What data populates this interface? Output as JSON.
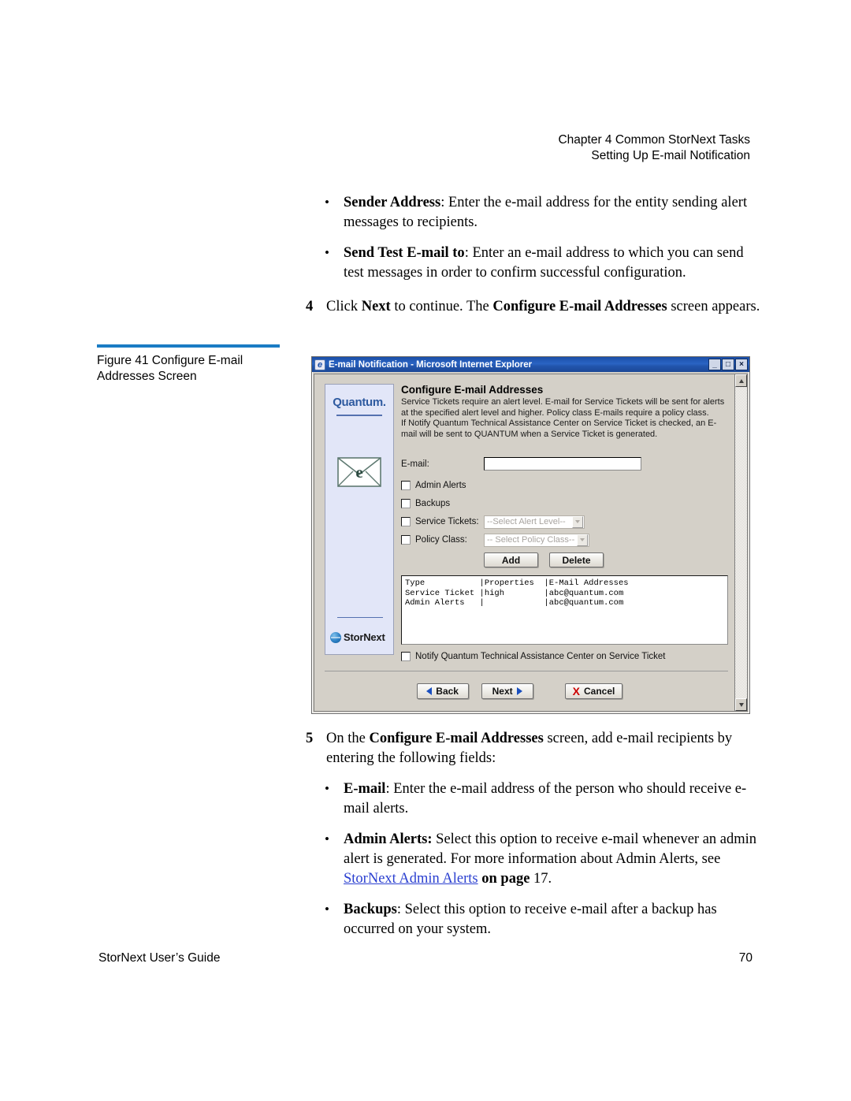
{
  "page_header": {
    "line1": "Chapter 4  Common StorNext Tasks",
    "line2": "Setting Up E-mail Notification"
  },
  "body": {
    "bullet1": {
      "bold": "Sender Address",
      "rest": ": Enter the e-mail address for the entity sending alert messages to recipients."
    },
    "bullet2": {
      "bold": "Send Test E-mail to",
      "rest": ": Enter an e-mail address to which you can send test messages in order to confirm successful configuration."
    },
    "step4": {
      "number": "4",
      "pre": "Click ",
      "bold1": "Next",
      "mid": " to continue. The ",
      "bold2": "Configure E-mail Addresses",
      "post": " screen appears."
    },
    "step5": {
      "number": "5",
      "pre": "On the ",
      "bold1": "Configure E-mail Addresses",
      "post": " screen, add e-mail recipients by entering the following fields:"
    },
    "bullet3": {
      "bold": "E-mail",
      "rest": ": Enter the e-mail address of the person who should receive e-mail alerts."
    },
    "bullet4": {
      "bold": "Admin Alerts:",
      "rest": " Select this option to receive e-mail whenever an admin alert is generated. For more information about Admin Alerts, see ",
      "link": "StorNext Admin Alerts",
      "tail_bold": " on page ",
      "tail": " 17."
    },
    "bullet5": {
      "bold": "Backups",
      "rest": ": Select this option to receive e-mail after a backup has occurred on your system."
    }
  },
  "figure": {
    "caption": "Figure 41  Configure E-mail Addresses Screen",
    "rule_color": "#1a7cc4"
  },
  "window": {
    "title": "E-mail Notification - Microsoft Internet Explorer",
    "icon": "internet-explorer-icon",
    "minimize": "_",
    "maximize": "□",
    "close": "×"
  },
  "sidebar": {
    "brand": "Quantum.",
    "envelope_letter": "e",
    "product": "StorNext"
  },
  "dialog": {
    "heading": "Configure E-mail Addresses",
    "desc_line1": "Service Tickets require an alert level. E-mail for Service Tickets will be sent for alerts at the specified alert level and higher. Policy class E-mails require a policy class.",
    "desc_line2": "If Notify Quantum Technical Assistance Center on Service Ticket is checked, an E-mail will be sent to QUANTUM when a Service Ticket is generated.",
    "email_label": "E-mail:",
    "email_value": "",
    "email_placeholder": "",
    "checkboxes": [
      {
        "label": "Admin Alerts",
        "checked": false
      },
      {
        "label": "Backups",
        "checked": false
      },
      {
        "label": "Service Tickets:",
        "checked": false
      },
      {
        "label": "Policy Class:",
        "checked": false
      }
    ],
    "select_alert_level": "--Select Alert Level--",
    "select_policy_class": "-- Select Policy Class--",
    "add_label": "Add",
    "delete_label": "Delete",
    "table": {
      "headers": [
        "Type",
        "Properties",
        "E-Mail Addresses"
      ],
      "text": "Type           |Properties  |E-Mail Addresses\nService Ticket |high        |abc@quantum.com\nAdmin Alerts   |            |abc@quantum.com",
      "rows": [
        {
          "type": "Service Ticket",
          "properties": "high",
          "email": "abc@quantum.com"
        },
        {
          "type": "Admin Alerts",
          "properties": "",
          "email": "abc@quantum.com"
        }
      ]
    },
    "notify_label": "Notify Quantum Technical Assistance Center on Service Ticket",
    "notify_checked": false,
    "nav": {
      "back": "Back",
      "next": "Next",
      "cancel": "Cancel",
      "cancel_mark": "X"
    }
  },
  "footer": {
    "left": "StorNext User’s Guide",
    "right": "70"
  }
}
